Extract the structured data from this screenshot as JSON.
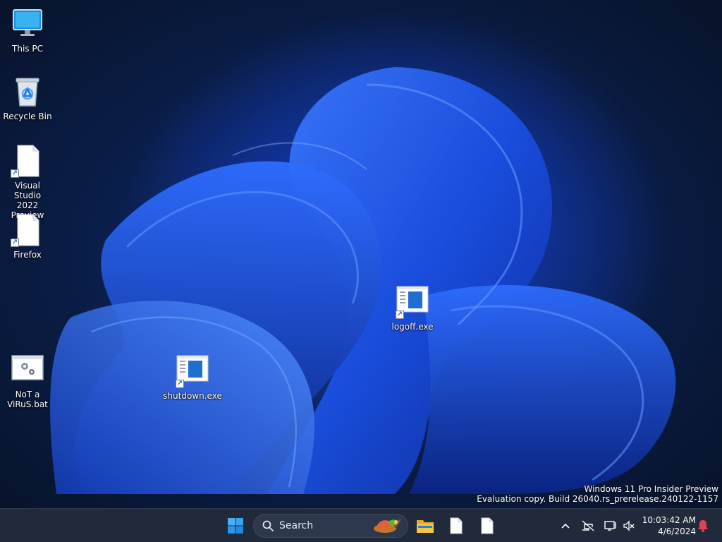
{
  "desktop": {
    "icons": [
      {
        "label": "This PC",
        "icon": "monitor-icon"
      },
      {
        "label": "Recycle Bin",
        "icon": "recycle-bin-icon"
      },
      {
        "label": "Visual Studio\n2022 Preview",
        "icon": "file-shortcut-icon"
      },
      {
        "label": "Firefox",
        "icon": "file-shortcut-icon"
      },
      {
        "label": "NoT a\nViRuS.bat",
        "icon": "batch-file-icon"
      },
      {
        "label": "shutdown.exe",
        "icon": "exe-shortcut-icon"
      },
      {
        "label": "logoff.exe",
        "icon": "exe-shortcut-icon"
      }
    ],
    "watermark": {
      "line1": "Windows 11 Pro Insider Preview",
      "line2": "Evaluation copy. Build 26040.rs_prerelease.240122-1157"
    }
  },
  "taskbar": {
    "search_placeholder": "Search",
    "time": "10:03:42 AM",
    "date": "4/6/2024",
    "apps": [
      "file-explorer-icon",
      "document-icon",
      "document-icon"
    ],
    "tray_icons": [
      "chevron-up-icon",
      "network-icon",
      "display-icon",
      "volume-mute-icon",
      "notification-bell-icon"
    ]
  },
  "colors": {
    "taskbar_bg": "#202a3b",
    "accent": "#3b8df5",
    "notification": "#e0424f"
  }
}
